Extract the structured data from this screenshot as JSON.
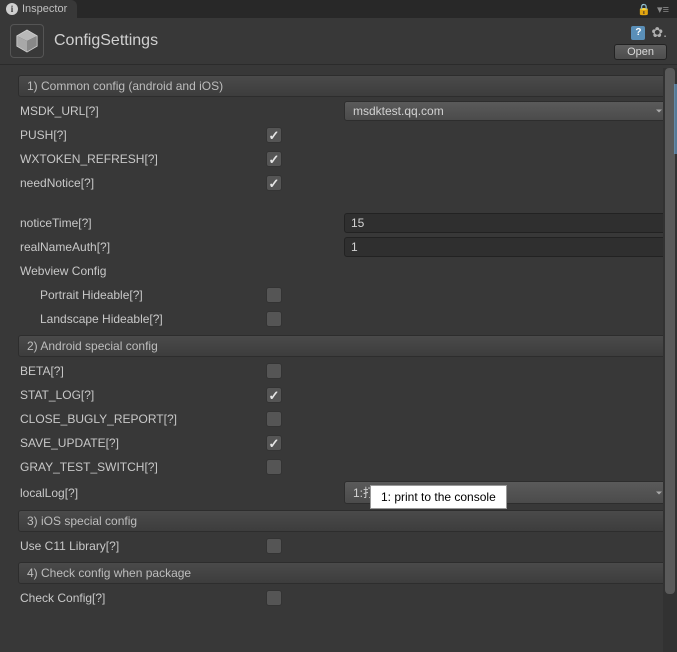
{
  "tab": {
    "title": "Inspector"
  },
  "asset": {
    "title": "ConfigSettings",
    "open_label": "Open"
  },
  "section1": {
    "title": "1) Common config (android and iOS)"
  },
  "common": {
    "msdk_url_label": "MSDK_URL[?]",
    "msdk_url_value": "msdktest.qq.com",
    "push_label": "PUSH[?]",
    "push_checked": true,
    "wxtoken_label": "WXTOKEN_REFRESH[?]",
    "wxtoken_checked": true,
    "neednotice_label": "needNotice[?]",
    "neednotice_checked": true,
    "noticetime_label": "noticeTime[?]",
    "noticetime_value": "15",
    "realnameauth_label": "realNameAuth[?]",
    "realnameauth_value": "1",
    "webview_label": "Webview Config",
    "portrait_label": "Portrait Hideable[?]",
    "portrait_checked": false,
    "landscape_label": "Landscape Hideable[?]",
    "landscape_checked": false
  },
  "section2": {
    "title": "2) Android special config"
  },
  "android": {
    "beta_label": "BETA[?]",
    "beta_checked": false,
    "statlog_label": "STAT_LOG[?]",
    "statlog_checked": true,
    "closebugly_label": "CLOSE_BUGLY_REPORT[?]",
    "closebugly_checked": false,
    "saveupdate_label": "SAVE_UPDATE[?]",
    "saveupdate_checked": true,
    "graytest_label": "GRAY_TEST_SWITCH[?]",
    "graytest_checked": false,
    "locallog_label": "localLog[?]",
    "locallog_value": "1:打印到控制台"
  },
  "section3": {
    "title": "3) iOS special config"
  },
  "ios": {
    "c11_label": "Use C11 Library[?]",
    "c11_checked": false
  },
  "section4": {
    "title": "4) Check config when package"
  },
  "check": {
    "check_label": "Check Config[?]",
    "check_checked": false
  },
  "tooltip": {
    "text": "1: print to the console"
  }
}
